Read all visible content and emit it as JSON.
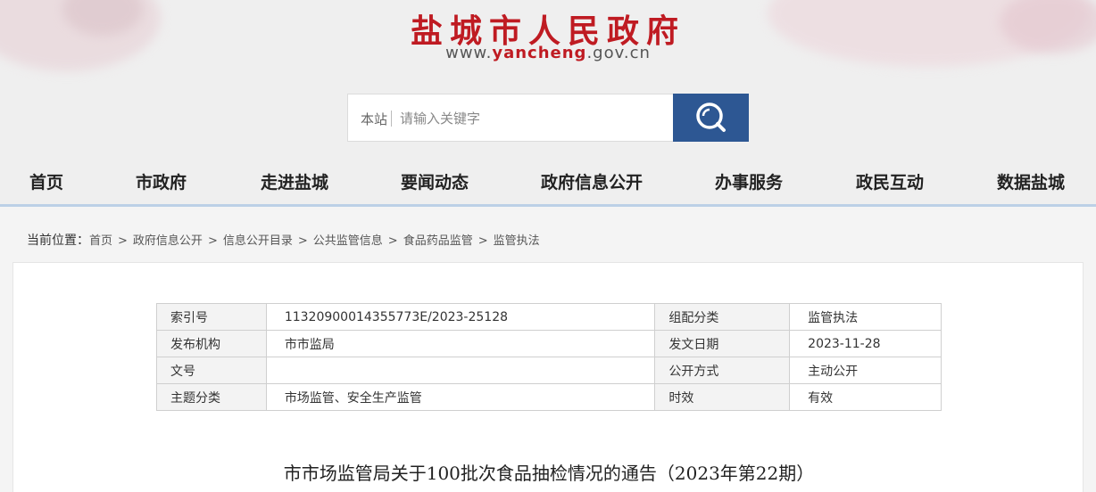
{
  "header": {
    "site_title": "盐城市人民政府",
    "url_prefix": "www.",
    "url_domain": "yancheng",
    "url_suffix": ".gov.cn",
    "brand_color": "#bf1b22",
    "search": {
      "scope": "本站",
      "placeholder": "请输入关键字",
      "button_icon": "search-icon",
      "button_color": "#2d5793"
    }
  },
  "nav": {
    "items": [
      {
        "label": "首页"
      },
      {
        "label": "市政府"
      },
      {
        "label": "走进盐城"
      },
      {
        "label": "要闻动态"
      },
      {
        "label": "政府信息公开"
      },
      {
        "label": "办事服务"
      },
      {
        "label": "政民互动"
      },
      {
        "label": "数据盐城"
      }
    ]
  },
  "breadcrumb": {
    "lead": "当前位置：",
    "items": [
      "首页",
      "政府信息公开",
      "信息公开目录",
      "公共监管信息",
      "食品药品监管",
      "监管执法"
    ],
    "separator": ">"
  },
  "meta": {
    "rows": [
      {
        "k1": "索引号",
        "v1": "11320900014355773E/2023-25128",
        "k2": "组配分类",
        "v2": "监管执法"
      },
      {
        "k1": "发布机构",
        "v1": "市市监局",
        "k2": "发文日期",
        "v2": "2023-11-28"
      },
      {
        "k1": "文号",
        "v1": "",
        "k2": "公开方式",
        "v2": "主动公开"
      },
      {
        "k1": "主题分类",
        "v1": "市场监管、安全生产监管",
        "k2": "时效",
        "v2": "有效"
      }
    ]
  },
  "article": {
    "title": "市市场监管局关于100批次食品抽检情况的通告（2023年第22期）"
  }
}
